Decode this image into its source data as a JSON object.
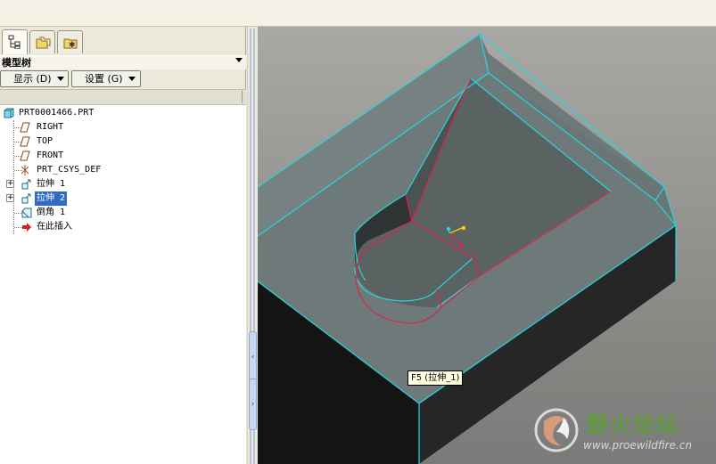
{
  "panel": {
    "title": "模型树",
    "show_label": "显示 (D)",
    "settings_label": "设置 (G)"
  },
  "tree": {
    "root": "PRT0001466.PRT",
    "items": [
      {
        "label": "RIGHT",
        "icon": "datum-plane-icon"
      },
      {
        "label": "TOP",
        "icon": "datum-plane-icon"
      },
      {
        "label": "FRONT",
        "icon": "datum-plane-icon"
      },
      {
        "label": "PRT_CSYS_DEF",
        "icon": "coordinate-system-icon"
      },
      {
        "label": "拉伸 1",
        "icon": "extrude-icon",
        "expandable": true
      },
      {
        "label": "拉伸 2",
        "icon": "extrude-icon",
        "expandable": true,
        "selected": true
      },
      {
        "label": "倒角 1",
        "icon": "chamfer-icon"
      },
      {
        "label": "在此插入",
        "icon": "insert-here-arrow-icon"
      }
    ]
  },
  "viewport": {
    "tooltip": "F5 (拉伸_1)",
    "edge_color": "#27d6e0",
    "highlight_color": "#e0204a"
  },
  "watermark": {
    "title": "野火论坛",
    "url": "www.proewildfire.cn"
  }
}
